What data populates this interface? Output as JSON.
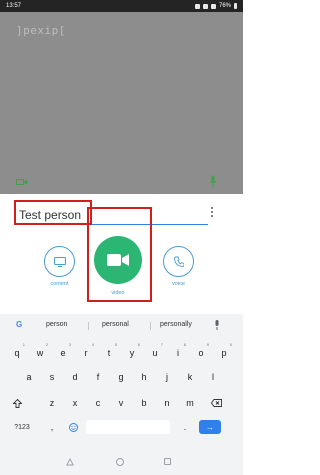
{
  "status_bar": {
    "time": "13:57",
    "battery": "76%"
  },
  "video_area": {
    "logo_text": "]pexip["
  },
  "name_field": {
    "value": "Test person"
  },
  "call_buttons": [
    {
      "label": "content",
      "icon": "monitor-icon"
    },
    {
      "label": "video",
      "icon": "camera-icon"
    },
    {
      "label": "voice",
      "icon": "phone-icon"
    }
  ],
  "keyboard": {
    "suggestions": [
      "person",
      "personal",
      "personally"
    ],
    "row1": [
      "q",
      "w",
      "e",
      "r",
      "t",
      "y",
      "u",
      "i",
      "o",
      "p"
    ],
    "row1_sup": [
      "1",
      "2",
      "3",
      "4",
      "5",
      "6",
      "7",
      "8",
      "9",
      "0"
    ],
    "row2": [
      "a",
      "s",
      "d",
      "f",
      "g",
      "h",
      "j",
      "k",
      "l"
    ],
    "row3": [
      "z",
      "x",
      "c",
      "v",
      "b",
      "n",
      "m"
    ],
    "symbols_key": "?123",
    "comma_key": ",",
    "period_key": "."
  },
  "colors": {
    "accent": "#2f80ed",
    "video_green": "#2bb673",
    "outline_blue": "#4a9bd1",
    "highlight_red": "#d0201d"
  }
}
